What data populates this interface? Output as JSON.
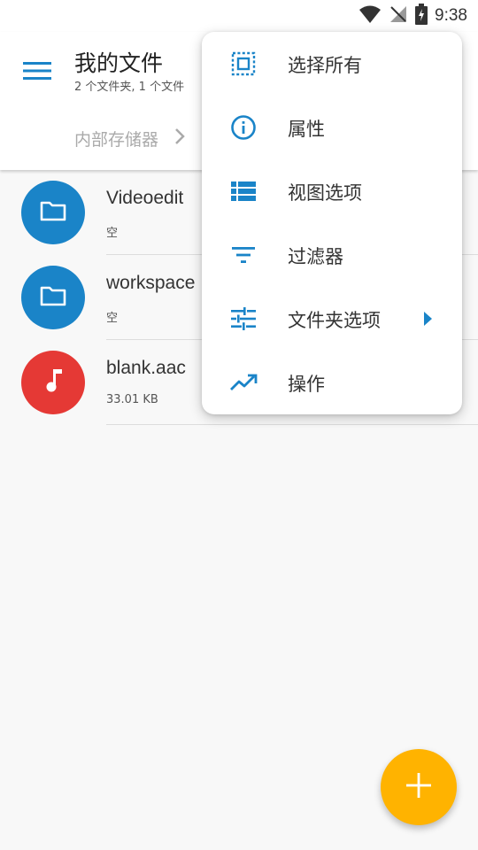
{
  "status_bar": {
    "time": "9:38",
    "icons": [
      "wifi-icon",
      "no-signal-icon",
      "battery-charging-icon"
    ]
  },
  "app_bar": {
    "menu_icon": "hamburger-menu-icon",
    "title": "我的文件",
    "subtitle": "2 个文件夹, 1 个文件",
    "breadcrumb": [
      "内部存储器"
    ],
    "breadcrumb_separator_icon": "chevron-right-icon"
  },
  "files": [
    {
      "name": "Videoedit",
      "meta": "空",
      "icon": "folder-icon",
      "color": "#1a84c8"
    },
    {
      "name": "workspace",
      "meta": "空",
      "icon": "folder-icon",
      "color": "#1a84c8"
    },
    {
      "name": "blank.aac",
      "meta": "33.01 KB",
      "icon": "music-note-icon",
      "color": "#e53935"
    }
  ],
  "menu": {
    "items": [
      {
        "label": "选择所有",
        "icon": "select-all-icon"
      },
      {
        "label": "属性",
        "icon": "info-icon"
      },
      {
        "label": "视图选项",
        "icon": "view-list-icon"
      },
      {
        "label": "过滤器",
        "icon": "filter-icon"
      },
      {
        "label": "文件夹选项",
        "icon": "tune-icon",
        "has_submenu": true
      },
      {
        "label": "操作",
        "icon": "trending-up-icon"
      }
    ]
  },
  "fab": {
    "icon": "add-icon"
  },
  "colors": {
    "accent": "#1a84c8",
    "audio": "#e53935",
    "fab": "#ffb300"
  }
}
